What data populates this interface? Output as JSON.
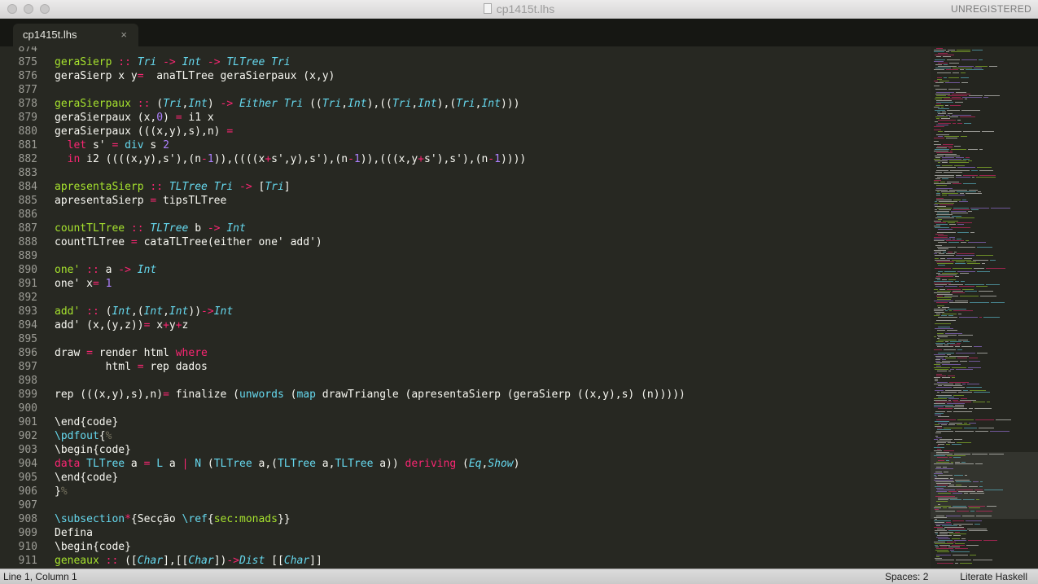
{
  "window": {
    "title": "cp1415t.lhs",
    "badge": "UNREGISTERED"
  },
  "tab": {
    "label": "cp1415t.lhs",
    "close": "×"
  },
  "status": {
    "position": "Line 1, Column 1",
    "spaces": "Spaces: 2",
    "syntax": "Literate Haskell"
  },
  "colors": {
    "background": "#272822",
    "keyword": "#f92672",
    "function": "#a6e22e",
    "type": "#66d9ef",
    "number": "#ae81ff",
    "text": "#f8f8f2"
  },
  "editor": {
    "lines": [
      {
        "n": "874",
        "s": []
      },
      {
        "n": "875",
        "s": [
          [
            "f",
            "geraSierp"
          ],
          [
            "t",
            " "
          ],
          [
            "k",
            "::"
          ],
          [
            "t",
            " "
          ],
          [
            "ti",
            "Tri"
          ],
          [
            "t",
            " "
          ],
          [
            "k",
            "->"
          ],
          [
            "t",
            " "
          ],
          [
            "ti",
            "Int"
          ],
          [
            "t",
            " "
          ],
          [
            "k",
            "->"
          ],
          [
            "t",
            " "
          ],
          [
            "ti",
            "TLTree"
          ],
          [
            "t",
            " "
          ],
          [
            "ti",
            "Tri"
          ]
        ]
      },
      {
        "n": "876",
        "s": [
          [
            "t",
            "geraSierp x y"
          ],
          [
            "k",
            "="
          ],
          [
            "t",
            "  anaTLTree geraSierpaux (x,y)"
          ]
        ]
      },
      {
        "n": "877",
        "s": []
      },
      {
        "n": "878",
        "s": [
          [
            "f",
            "geraSierpaux"
          ],
          [
            "t",
            " "
          ],
          [
            "k",
            "::"
          ],
          [
            "t",
            " ("
          ],
          [
            "ti",
            "Tri"
          ],
          [
            "t",
            ","
          ],
          [
            "ti",
            "Int"
          ],
          [
            "t",
            ") "
          ],
          [
            "k",
            "->"
          ],
          [
            "t",
            " "
          ],
          [
            "ti",
            "Either"
          ],
          [
            "t",
            " "
          ],
          [
            "ti",
            "Tri"
          ],
          [
            "t",
            " (("
          ],
          [
            "ti",
            "Tri"
          ],
          [
            "t",
            ","
          ],
          [
            "ti",
            "Int"
          ],
          [
            "t",
            "),(("
          ],
          [
            "ti",
            "Tri"
          ],
          [
            "t",
            ","
          ],
          [
            "ti",
            "Int"
          ],
          [
            "t",
            "),("
          ],
          [
            "ti",
            "Tri"
          ],
          [
            "t",
            ","
          ],
          [
            "ti",
            "Int"
          ],
          [
            "t",
            ")))"
          ]
        ]
      },
      {
        "n": "879",
        "s": [
          [
            "t",
            "geraSierpaux (x,"
          ],
          [
            "n",
            "0"
          ],
          [
            "t",
            ") "
          ],
          [
            "k",
            "="
          ],
          [
            "t",
            " i1 x"
          ]
        ]
      },
      {
        "n": "880",
        "s": [
          [
            "t",
            "geraSierpaux (((x,y),s),n) "
          ],
          [
            "k",
            "="
          ]
        ]
      },
      {
        "n": "881",
        "s": [
          [
            "t",
            "  "
          ],
          [
            "k",
            "let"
          ],
          [
            "t",
            " s' "
          ],
          [
            "k",
            "="
          ],
          [
            "t",
            " "
          ],
          [
            "ty",
            "div"
          ],
          [
            "t",
            " s "
          ],
          [
            "n",
            "2"
          ]
        ]
      },
      {
        "n": "882",
        "s": [
          [
            "t",
            "  "
          ],
          [
            "k",
            "in"
          ],
          [
            "t",
            " i2 ((((x,y),s'),(n"
          ],
          [
            "k",
            "-"
          ],
          [
            "n",
            "1"
          ],
          [
            "t",
            ")),((((x"
          ],
          [
            "k",
            "+"
          ],
          [
            "t",
            "s',y),s'),(n"
          ],
          [
            "k",
            "-"
          ],
          [
            "n",
            "1"
          ],
          [
            "t",
            ")),(((x,y"
          ],
          [
            "k",
            "+"
          ],
          [
            "t",
            "s'),s'),(n"
          ],
          [
            "k",
            "-"
          ],
          [
            "n",
            "1"
          ],
          [
            "t",
            "))))"
          ]
        ]
      },
      {
        "n": "883",
        "s": []
      },
      {
        "n": "884",
        "s": [
          [
            "f",
            "apresentaSierp"
          ],
          [
            "t",
            " "
          ],
          [
            "k",
            "::"
          ],
          [
            "t",
            " "
          ],
          [
            "ti",
            "TLTree"
          ],
          [
            "t",
            " "
          ],
          [
            "ti",
            "Tri"
          ],
          [
            "t",
            " "
          ],
          [
            "k",
            "->"
          ],
          [
            "t",
            " ["
          ],
          [
            "ti",
            "Tri"
          ],
          [
            "t",
            "]"
          ]
        ]
      },
      {
        "n": "885",
        "s": [
          [
            "t",
            "apresentaSierp "
          ],
          [
            "k",
            "="
          ],
          [
            "t",
            " tipsTLTree"
          ]
        ]
      },
      {
        "n": "886",
        "s": []
      },
      {
        "n": "887",
        "s": [
          [
            "f",
            "countTLTree"
          ],
          [
            "t",
            " "
          ],
          [
            "k",
            "::"
          ],
          [
            "t",
            " "
          ],
          [
            "ti",
            "TLTree"
          ],
          [
            "t",
            " b "
          ],
          [
            "k",
            "->"
          ],
          [
            "t",
            " "
          ],
          [
            "ti",
            "Int"
          ]
        ]
      },
      {
        "n": "888",
        "s": [
          [
            "t",
            "countTLTree "
          ],
          [
            "k",
            "="
          ],
          [
            "t",
            " cataTLTree(either one' add')"
          ]
        ]
      },
      {
        "n": "889",
        "s": []
      },
      {
        "n": "890",
        "s": [
          [
            "f",
            "one'"
          ],
          [
            "t",
            " "
          ],
          [
            "k",
            "::"
          ],
          [
            "t",
            " a "
          ],
          [
            "k",
            "->"
          ],
          [
            "t",
            " "
          ],
          [
            "ti",
            "Int"
          ]
        ]
      },
      {
        "n": "891",
        "s": [
          [
            "t",
            "one' x"
          ],
          [
            "k",
            "="
          ],
          [
            "t",
            " "
          ],
          [
            "n",
            "1"
          ]
        ]
      },
      {
        "n": "892",
        "s": []
      },
      {
        "n": "893",
        "s": [
          [
            "f",
            "add'"
          ],
          [
            "t",
            " "
          ],
          [
            "k",
            "::"
          ],
          [
            "t",
            " ("
          ],
          [
            "ti",
            "Int"
          ],
          [
            "t",
            ",("
          ],
          [
            "ti",
            "Int"
          ],
          [
            "t",
            ","
          ],
          [
            "ti",
            "Int"
          ],
          [
            "t",
            "))"
          ],
          [
            "k",
            "->"
          ],
          [
            "ti",
            "Int"
          ]
        ]
      },
      {
        "n": "894",
        "s": [
          [
            "t",
            "add' (x,(y,z))"
          ],
          [
            "k",
            "="
          ],
          [
            "t",
            " x"
          ],
          [
            "k",
            "+"
          ],
          [
            "t",
            "y"
          ],
          [
            "k",
            "+"
          ],
          [
            "t",
            "z"
          ]
        ]
      },
      {
        "n": "895",
        "s": []
      },
      {
        "n": "896",
        "s": [
          [
            "t",
            "draw "
          ],
          [
            "k",
            "="
          ],
          [
            "t",
            " render html "
          ],
          [
            "k",
            "where"
          ]
        ]
      },
      {
        "n": "897",
        "s": [
          [
            "t",
            "        html "
          ],
          [
            "k",
            "="
          ],
          [
            "t",
            " rep dados"
          ]
        ]
      },
      {
        "n": "898",
        "s": []
      },
      {
        "n": "899",
        "s": [
          [
            "t",
            "rep (((x,y),s),n)"
          ],
          [
            "k",
            "="
          ],
          [
            "t",
            " finalize ("
          ],
          [
            "ty",
            "unwords"
          ],
          [
            "t",
            " ("
          ],
          [
            "ty",
            "map"
          ],
          [
            "t",
            " drawTriangle (apresentaSierp (geraSierp ((x,y),s) (n)))))"
          ]
        ]
      },
      {
        "n": "900",
        "s": []
      },
      {
        "n": "901",
        "s": [
          [
            "t",
            "\\end{code}"
          ]
        ]
      },
      {
        "n": "902",
        "s": [
          [
            "ty",
            "\\pdfout"
          ],
          [
            "t",
            "{"
          ],
          [
            "g",
            "%"
          ]
        ]
      },
      {
        "n": "903",
        "s": [
          [
            "t",
            "\\begin{code}"
          ]
        ]
      },
      {
        "n": "904",
        "s": [
          [
            "k",
            "data"
          ],
          [
            "t",
            " "
          ],
          [
            "ty",
            "TLTree"
          ],
          [
            "t",
            " a "
          ],
          [
            "k",
            "="
          ],
          [
            "t",
            " "
          ],
          [
            "ty",
            "L"
          ],
          [
            "t",
            " a "
          ],
          [
            "k",
            "|"
          ],
          [
            "t",
            " "
          ],
          [
            "ty",
            "N"
          ],
          [
            "t",
            " ("
          ],
          [
            "ty",
            "TLTree"
          ],
          [
            "t",
            " a,("
          ],
          [
            "ty",
            "TLTree"
          ],
          [
            "t",
            " a,"
          ],
          [
            "ty",
            "TLTree"
          ],
          [
            "t",
            " a)) "
          ],
          [
            "k",
            "deriving"
          ],
          [
            "t",
            " ("
          ],
          [
            "ti",
            "Eq"
          ],
          [
            "t",
            ","
          ],
          [
            "ti",
            "Show"
          ],
          [
            "t",
            ")"
          ]
        ]
      },
      {
        "n": "905",
        "s": [
          [
            "t",
            "\\end{code}"
          ]
        ]
      },
      {
        "n": "906",
        "s": [
          [
            "t",
            "}"
          ],
          [
            "g",
            "%"
          ]
        ]
      },
      {
        "n": "907",
        "s": []
      },
      {
        "n": "908",
        "s": [
          [
            "ty",
            "\\subsection"
          ],
          [
            "k",
            "*"
          ],
          [
            "t",
            "{Secção "
          ],
          [
            "ty",
            "\\ref"
          ],
          [
            "t",
            "{"
          ],
          [
            "f",
            "sec:monads"
          ],
          [
            "t",
            "}}"
          ]
        ]
      },
      {
        "n": "909",
        "s": [
          [
            "t",
            "Defina"
          ]
        ]
      },
      {
        "n": "910",
        "s": [
          [
            "t",
            "\\begin{code}"
          ]
        ]
      },
      {
        "n": "911",
        "s": [
          [
            "f",
            "geneaux"
          ],
          [
            "t",
            " "
          ],
          [
            "k",
            "::"
          ],
          [
            "t",
            " (["
          ],
          [
            "ti",
            "Char"
          ],
          [
            "t",
            "],[["
          ],
          [
            "ti",
            "Char"
          ],
          [
            "t",
            "])"
          ],
          [
            "k",
            "->"
          ],
          [
            "ti",
            "Dist"
          ],
          [
            "t",
            " [["
          ],
          [
            "ti",
            "Char"
          ],
          [
            "t",
            "]]"
          ]
        ]
      }
    ]
  }
}
